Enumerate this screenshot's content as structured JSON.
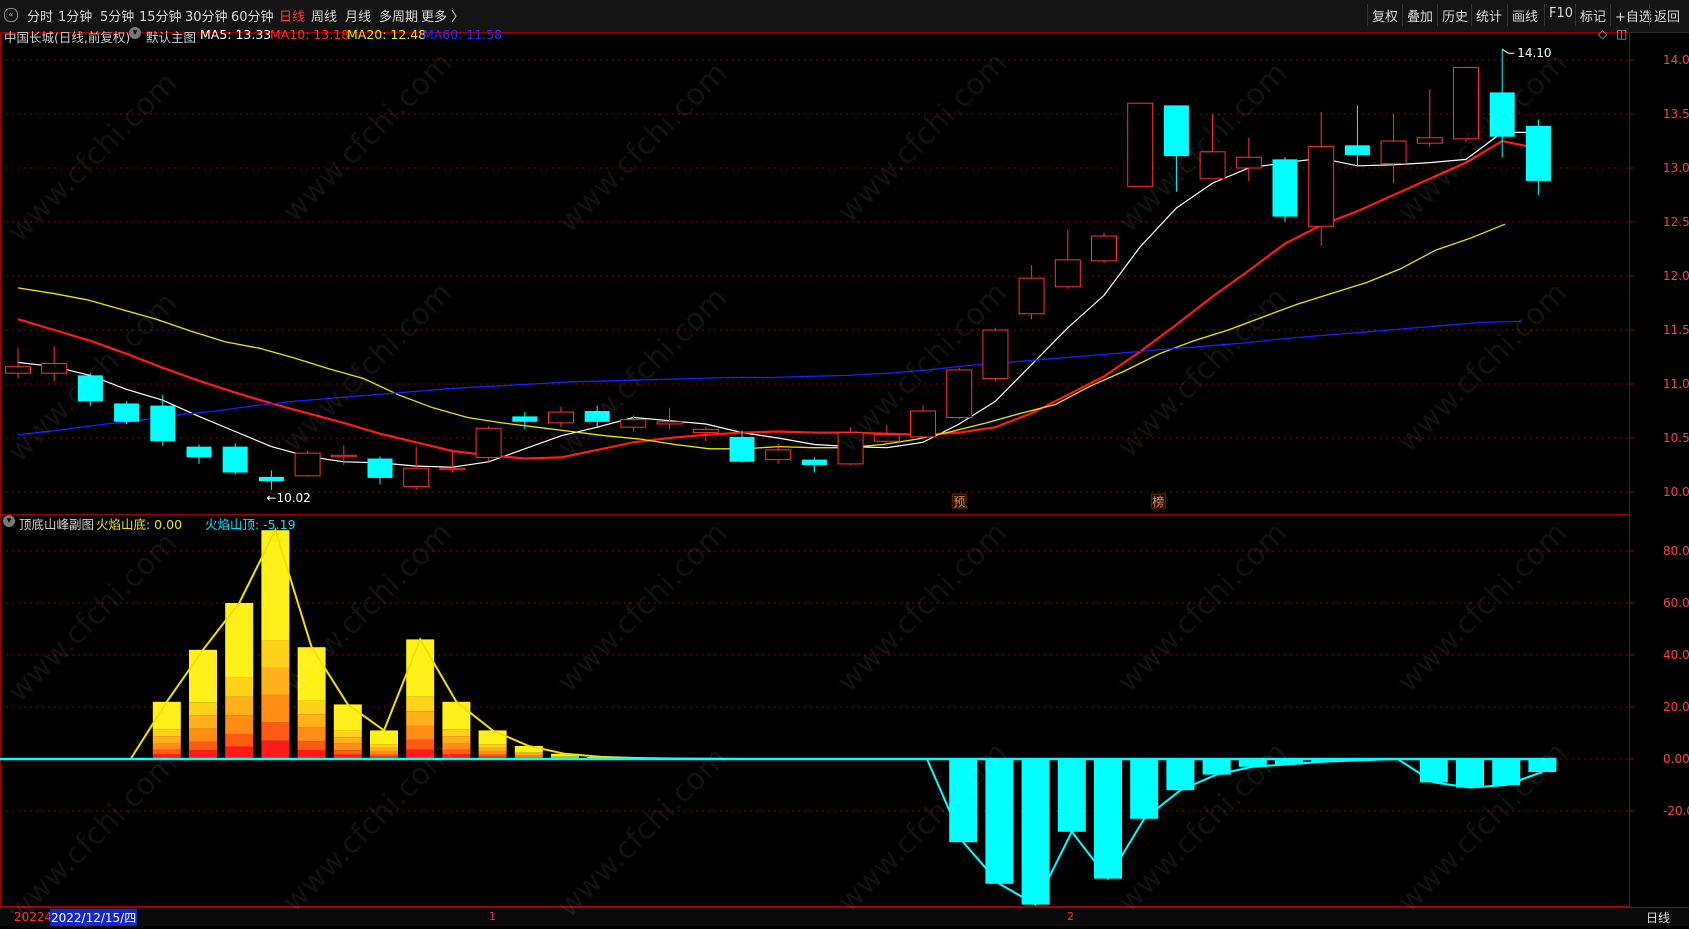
{
  "toolbar": {
    "nav_icon": "double-chevron-left-icon",
    "left_items": [
      "分时",
      "1分钟",
      "5分钟",
      "15分钟",
      "30分钟",
      "60分钟",
      "日线",
      "周线",
      "月线",
      "多周期",
      "更多 〉"
    ],
    "active_item": "日线",
    "right_items": [
      "复权",
      "叠加",
      "历史",
      "统计",
      "画线",
      "F10",
      "标记",
      "+自选",
      "返回"
    ]
  },
  "main_chart": {
    "title": "中国长城(日线,前复权)",
    "menu_label": "默认主图",
    "ma_labels": [
      {
        "text": "MA5: 13.33",
        "color": "#ffffff"
      },
      {
        "text": "MA10: 13.18",
        "color": "#ff2a2a"
      },
      {
        "text": "MA20: 12.48",
        "color": "#e8e800"
      },
      {
        "text": "MA60: 11.58",
        "color": "#2b2bff"
      }
    ],
    "high_marker": "14.10",
    "low_marker": "10.02",
    "event_markers": [
      "预",
      "榜"
    ],
    "corner_icons": [
      "diamond-icon",
      "square-icon"
    ]
  },
  "sub_chart": {
    "title": "顶底山峰副图",
    "labels": [
      {
        "text": "火焰山底: 0.00",
        "color": "#e8e800"
      },
      {
        "text": "火焰山顶: -5.19",
        "color": "#00e5ff"
      }
    ]
  },
  "bottom": {
    "date_start": "20224",
    "date_selected": "2022/12/15/四",
    "month_marks": [
      "1",
      "2"
    ],
    "period_label": "日线"
  },
  "watermark": "www.cfchi.com",
  "colors": {
    "up": "#ff3030",
    "down": "#00ffff",
    "ma5": "#ffffff",
    "ma10": "#ff1a1a",
    "ma20": "#e6e600",
    "ma60": "#1e1eff",
    "grid": "#8b0000",
    "axis_text": "#ff4040"
  },
  "chart_data": [
    {
      "type": "candlestick",
      "title": "中国长城(日线,前复权)",
      "ylim": [
        9.85,
        14.28
      ],
      "y_ticks": [
        "14.00",
        "13.50",
        "13.00",
        "12.50",
        "12.00",
        "11.50",
        "11.00",
        "10.50",
        "10.00"
      ],
      "candles": [
        [
          11.1,
          11.16,
          11.05,
          11.33
        ],
        [
          11.1,
          11.19,
          11.02,
          11.35
        ],
        [
          11.08,
          10.84,
          10.8,
          11.1
        ],
        [
          10.82,
          10.65,
          10.63,
          10.84
        ],
        [
          10.8,
          10.47,
          10.43,
          10.9
        ],
        [
          10.42,
          10.32,
          10.26,
          10.44
        ],
        [
          10.42,
          10.18,
          10.16,
          10.45
        ],
        [
          10.14,
          10.1,
          10.02,
          10.2
        ],
        [
          10.15,
          10.36,
          10.14,
          10.38
        ],
        [
          10.33,
          10.34,
          10.25,
          10.43
        ],
        [
          10.31,
          10.13,
          10.07,
          10.33
        ],
        [
          10.05,
          10.22,
          10.02,
          10.42
        ],
        [
          10.21,
          10.22,
          10.18,
          10.37
        ],
        [
          10.32,
          10.59,
          10.28,
          10.61
        ],
        [
          10.7,
          10.65,
          10.58,
          10.74
        ],
        [
          10.64,
          10.74,
          10.6,
          10.79
        ],
        [
          10.75,
          10.65,
          10.6,
          10.8
        ],
        [
          10.6,
          10.67,
          10.56,
          10.71
        ],
        [
          10.63,
          10.65,
          10.58,
          10.78
        ],
        [
          10.55,
          10.58,
          10.47,
          10.6
        ],
        [
          10.51,
          10.28,
          10.27,
          10.57
        ],
        [
          10.3,
          10.39,
          10.26,
          10.45
        ],
        [
          10.3,
          10.25,
          10.18,
          10.32
        ],
        [
          10.26,
          10.55,
          10.25,
          10.6
        ],
        [
          10.47,
          10.53,
          10.43,
          10.62
        ],
        [
          10.51,
          10.75,
          10.49,
          10.8
        ],
        [
          10.69,
          11.13,
          10.67,
          11.15
        ],
        [
          11.05,
          11.5,
          11.03,
          11.52
        ],
        [
          11.65,
          11.98,
          11.6,
          12.1
        ],
        [
          11.9,
          12.15,
          11.88,
          12.43
        ],
        [
          12.14,
          12.37,
          12.12,
          12.4
        ],
        [
          12.83,
          13.6,
          12.82,
          13.6
        ],
        [
          13.58,
          13.11,
          12.78,
          13.58
        ],
        [
          12.9,
          13.15,
          12.9,
          13.5
        ],
        [
          13.0,
          13.1,
          12.88,
          13.28
        ],
        [
          13.08,
          12.55,
          12.5,
          13.1
        ],
        [
          12.46,
          13.2,
          12.28,
          13.52
        ],
        [
          13.21,
          13.12,
          13.02,
          13.58
        ],
        [
          13.04,
          13.25,
          12.86,
          13.5
        ],
        [
          13.23,
          13.28,
          13.2,
          13.73
        ],
        [
          13.27,
          13.93,
          13.24,
          13.94
        ],
        [
          13.7,
          13.29,
          13.1,
          14.1
        ],
        [
          13.39,
          12.88,
          12.75,
          13.45
        ]
      ],
      "series": [
        {
          "name": "MA5",
          "values": [
            11.2,
            11.16,
            11.08,
            10.95,
            10.85,
            10.7,
            10.56,
            10.42,
            10.33,
            10.28,
            10.27,
            10.24,
            10.23,
            10.28,
            10.4,
            10.52,
            10.6,
            10.69,
            10.66,
            10.63,
            10.55,
            10.5,
            10.44,
            10.42,
            10.41,
            10.46,
            10.63,
            10.84,
            11.18,
            11.52,
            11.82,
            12.27,
            12.63,
            12.86,
            13.0,
            13.05,
            13.09,
            13.02,
            13.03,
            13.05,
            13.08,
            13.33,
            13.33
          ]
        },
        {
          "name": "MA10",
          "values": [
            11.6,
            11.5,
            11.4,
            11.28,
            11.15,
            11.03,
            10.92,
            10.82,
            10.73,
            10.64,
            10.54,
            10.46,
            10.38,
            10.34,
            10.31,
            10.32,
            10.39,
            10.46,
            10.5,
            10.53,
            10.55,
            10.56,
            10.55,
            10.55,
            10.54,
            10.53,
            10.55,
            10.6,
            10.73,
            10.9,
            11.07,
            11.3,
            11.55,
            11.81,
            12.05,
            12.3,
            12.47,
            12.6,
            12.75,
            12.9,
            13.05,
            13.25,
            13.18
          ]
        },
        {
          "name": "MA20",
          "values": [
            11.89,
            11.84,
            11.78,
            11.69,
            11.6,
            11.49,
            11.39,
            11.33,
            11.24,
            11.14,
            11.05,
            10.9,
            10.78,
            10.69,
            10.64,
            10.6,
            10.56,
            10.52,
            10.49,
            10.44,
            10.4,
            10.4,
            10.42,
            10.41,
            10.41,
            10.44,
            10.49,
            10.56,
            10.64,
            10.73,
            10.81,
            10.98,
            11.12,
            11.28,
            11.4,
            11.5,
            11.62,
            11.74,
            11.84,
            11.94,
            12.07,
            12.24,
            12.35,
            12.48
          ]
        },
        {
          "name": "MA60",
          "values": [
            10.53,
            10.57,
            10.62,
            10.66,
            10.71,
            10.75,
            10.8,
            10.84,
            10.87,
            10.9,
            10.93,
            10.96,
            10.98,
            11.0,
            11.02,
            11.03,
            11.04,
            11.05,
            11.06,
            11.06,
            11.07,
            11.08,
            11.1,
            11.13,
            11.17,
            11.2,
            11.23,
            11.26,
            11.29,
            11.32,
            11.35,
            11.38,
            11.42,
            11.45,
            11.48,
            11.51,
            11.54,
            11.57,
            11.58
          ]
        }
      ]
    },
    {
      "type": "bar",
      "title": "顶底山峰副图",
      "ylim": [
        -28,
        88
      ],
      "y_ticks": [
        "80.00",
        "60.00",
        "40.00",
        "20.00",
        "0.00",
        "-20.00"
      ],
      "values": [
        0,
        0,
        0,
        0,
        22,
        42,
        60,
        88,
        43,
        21,
        11,
        46,
        22,
        11,
        5,
        2,
        0.8,
        0.4,
        0.2,
        0.1,
        0,
        0,
        0,
        0,
        0,
        0,
        -32,
        -48,
        -56,
        -28,
        -46,
        -23,
        -12,
        -6,
        -3,
        -2,
        -1,
        -0.5,
        0,
        -9,
        -11,
        -10,
        -5
      ]
    }
  ]
}
